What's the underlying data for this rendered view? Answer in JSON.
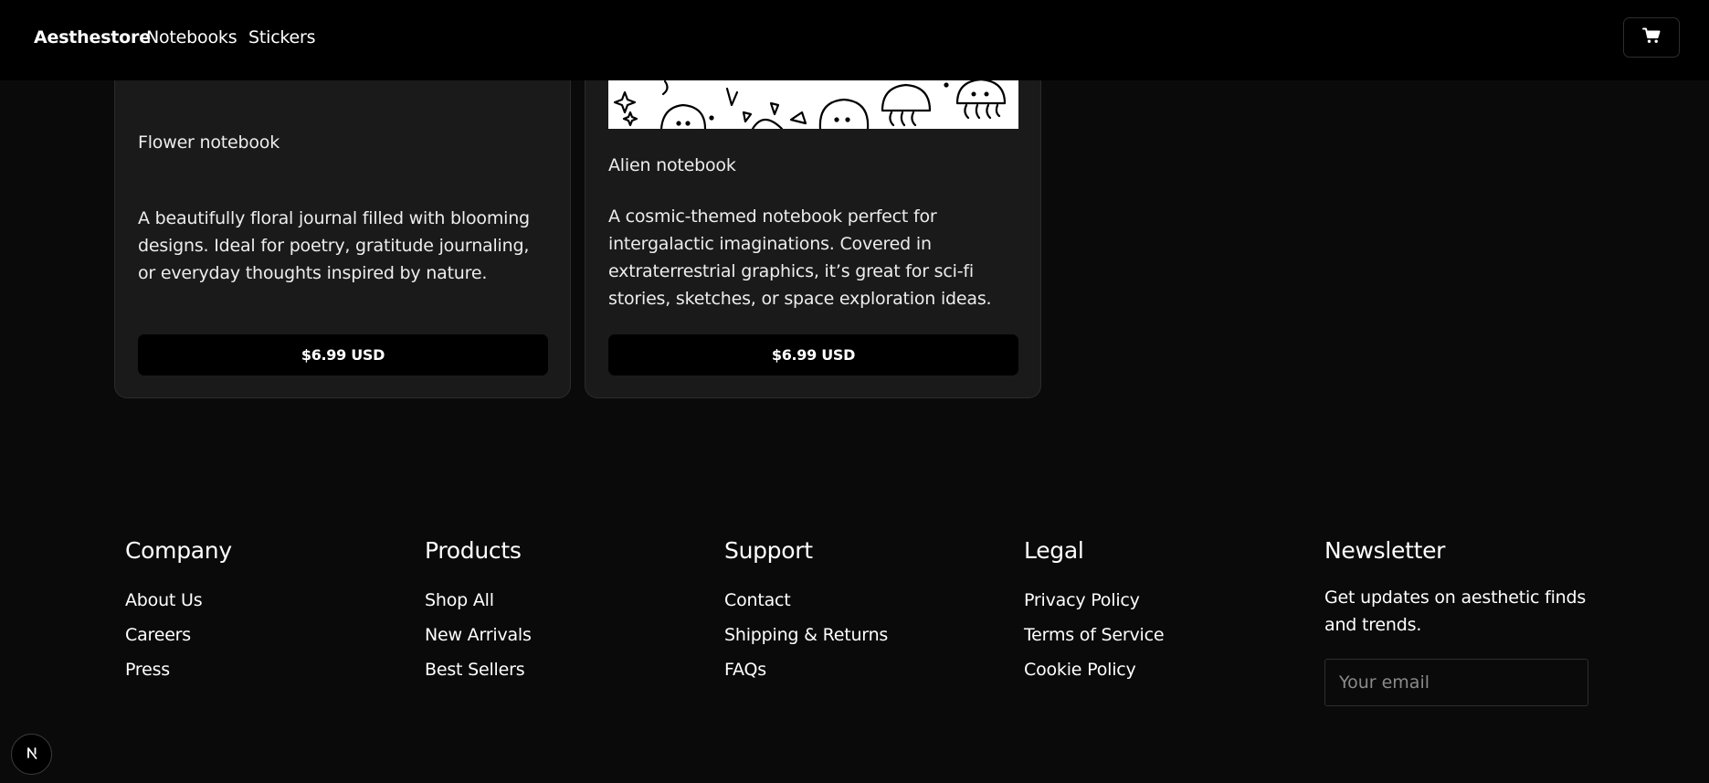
{
  "header": {
    "brand": "Aesthestore",
    "nav": [
      "Notebooks",
      "Stickers"
    ],
    "cart_icon": "shopping-cart-icon"
  },
  "products": [
    {
      "title": "Flower notebook",
      "description": "A beautifully floral journal filled with blooming designs. Ideal for poetry, gratitude journaling, or everyday thoughts inspired by nature.",
      "price": "$6.99 USD"
    },
    {
      "title": "Alien notebook",
      "description": "A cosmic-themed notebook perfect for intergalactic imaginations. Covered in extraterrestrial graphics, it’s great for sci-fi stories, sketches, or space exploration ideas.",
      "price": "$6.99 USD"
    }
  ],
  "footer": {
    "company": {
      "heading": "Company",
      "links": [
        "About Us",
        "Careers",
        "Press"
      ]
    },
    "products": {
      "heading": "Products",
      "links": [
        "Shop All",
        "New Arrivals",
        "Best Sellers"
      ]
    },
    "support": {
      "heading": "Support",
      "links": [
        "Contact",
        "Shipping & Returns",
        "FAQs"
      ]
    },
    "legal": {
      "heading": "Legal",
      "links": [
        "Privacy Policy",
        "Terms of Service",
        "Cookie Policy"
      ]
    },
    "newsletter": {
      "heading": "Newsletter",
      "text": "Get updates on aesthetic finds and trends.",
      "placeholder": "Your email"
    }
  },
  "dev_badge": {
    "label": "N",
    "icon": "nextjs-logo-icon"
  },
  "colors": {
    "background": "#0a0a0a",
    "header": "#000000",
    "card": "#1a1a1a",
    "button": "#000000"
  }
}
